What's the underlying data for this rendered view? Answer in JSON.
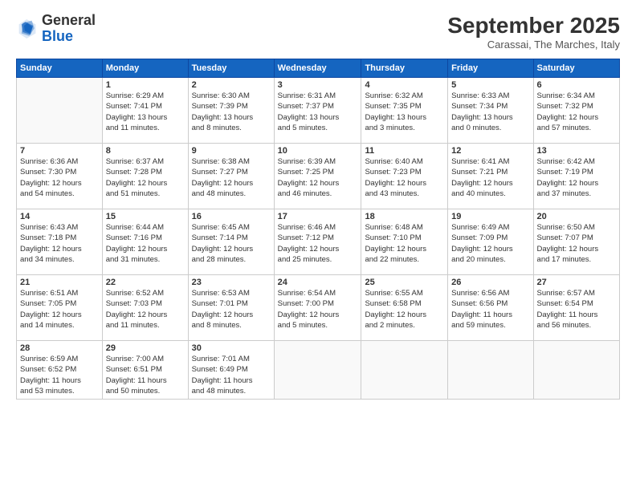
{
  "logo": {
    "general": "General",
    "blue": "Blue"
  },
  "title": "September 2025",
  "subtitle": "Carassai, The Marches, Italy",
  "days_of_week": [
    "Sunday",
    "Monday",
    "Tuesday",
    "Wednesday",
    "Thursday",
    "Friday",
    "Saturday"
  ],
  "weeks": [
    [
      {
        "day": "",
        "info": ""
      },
      {
        "day": "1",
        "info": "Sunrise: 6:29 AM\nSunset: 7:41 PM\nDaylight: 13 hours\nand 11 minutes."
      },
      {
        "day": "2",
        "info": "Sunrise: 6:30 AM\nSunset: 7:39 PM\nDaylight: 13 hours\nand 8 minutes."
      },
      {
        "day": "3",
        "info": "Sunrise: 6:31 AM\nSunset: 7:37 PM\nDaylight: 13 hours\nand 5 minutes."
      },
      {
        "day": "4",
        "info": "Sunrise: 6:32 AM\nSunset: 7:35 PM\nDaylight: 13 hours\nand 3 minutes."
      },
      {
        "day": "5",
        "info": "Sunrise: 6:33 AM\nSunset: 7:34 PM\nDaylight: 13 hours\nand 0 minutes."
      },
      {
        "day": "6",
        "info": "Sunrise: 6:34 AM\nSunset: 7:32 PM\nDaylight: 12 hours\nand 57 minutes."
      }
    ],
    [
      {
        "day": "7",
        "info": "Sunrise: 6:36 AM\nSunset: 7:30 PM\nDaylight: 12 hours\nand 54 minutes."
      },
      {
        "day": "8",
        "info": "Sunrise: 6:37 AM\nSunset: 7:28 PM\nDaylight: 12 hours\nand 51 minutes."
      },
      {
        "day": "9",
        "info": "Sunrise: 6:38 AM\nSunset: 7:27 PM\nDaylight: 12 hours\nand 48 minutes."
      },
      {
        "day": "10",
        "info": "Sunrise: 6:39 AM\nSunset: 7:25 PM\nDaylight: 12 hours\nand 46 minutes."
      },
      {
        "day": "11",
        "info": "Sunrise: 6:40 AM\nSunset: 7:23 PM\nDaylight: 12 hours\nand 43 minutes."
      },
      {
        "day": "12",
        "info": "Sunrise: 6:41 AM\nSunset: 7:21 PM\nDaylight: 12 hours\nand 40 minutes."
      },
      {
        "day": "13",
        "info": "Sunrise: 6:42 AM\nSunset: 7:19 PM\nDaylight: 12 hours\nand 37 minutes."
      }
    ],
    [
      {
        "day": "14",
        "info": "Sunrise: 6:43 AM\nSunset: 7:18 PM\nDaylight: 12 hours\nand 34 minutes."
      },
      {
        "day": "15",
        "info": "Sunrise: 6:44 AM\nSunset: 7:16 PM\nDaylight: 12 hours\nand 31 minutes."
      },
      {
        "day": "16",
        "info": "Sunrise: 6:45 AM\nSunset: 7:14 PM\nDaylight: 12 hours\nand 28 minutes."
      },
      {
        "day": "17",
        "info": "Sunrise: 6:46 AM\nSunset: 7:12 PM\nDaylight: 12 hours\nand 25 minutes."
      },
      {
        "day": "18",
        "info": "Sunrise: 6:48 AM\nSunset: 7:10 PM\nDaylight: 12 hours\nand 22 minutes."
      },
      {
        "day": "19",
        "info": "Sunrise: 6:49 AM\nSunset: 7:09 PM\nDaylight: 12 hours\nand 20 minutes."
      },
      {
        "day": "20",
        "info": "Sunrise: 6:50 AM\nSunset: 7:07 PM\nDaylight: 12 hours\nand 17 minutes."
      }
    ],
    [
      {
        "day": "21",
        "info": "Sunrise: 6:51 AM\nSunset: 7:05 PM\nDaylight: 12 hours\nand 14 minutes."
      },
      {
        "day": "22",
        "info": "Sunrise: 6:52 AM\nSunset: 7:03 PM\nDaylight: 12 hours\nand 11 minutes."
      },
      {
        "day": "23",
        "info": "Sunrise: 6:53 AM\nSunset: 7:01 PM\nDaylight: 12 hours\nand 8 minutes."
      },
      {
        "day": "24",
        "info": "Sunrise: 6:54 AM\nSunset: 7:00 PM\nDaylight: 12 hours\nand 5 minutes."
      },
      {
        "day": "25",
        "info": "Sunrise: 6:55 AM\nSunset: 6:58 PM\nDaylight: 12 hours\nand 2 minutes."
      },
      {
        "day": "26",
        "info": "Sunrise: 6:56 AM\nSunset: 6:56 PM\nDaylight: 11 hours\nand 59 minutes."
      },
      {
        "day": "27",
        "info": "Sunrise: 6:57 AM\nSunset: 6:54 PM\nDaylight: 11 hours\nand 56 minutes."
      }
    ],
    [
      {
        "day": "28",
        "info": "Sunrise: 6:59 AM\nSunset: 6:52 PM\nDaylight: 11 hours\nand 53 minutes."
      },
      {
        "day": "29",
        "info": "Sunrise: 7:00 AM\nSunset: 6:51 PM\nDaylight: 11 hours\nand 50 minutes."
      },
      {
        "day": "30",
        "info": "Sunrise: 7:01 AM\nSunset: 6:49 PM\nDaylight: 11 hours\nand 48 minutes."
      },
      {
        "day": "",
        "info": ""
      },
      {
        "day": "",
        "info": ""
      },
      {
        "day": "",
        "info": ""
      },
      {
        "day": "",
        "info": ""
      }
    ]
  ]
}
